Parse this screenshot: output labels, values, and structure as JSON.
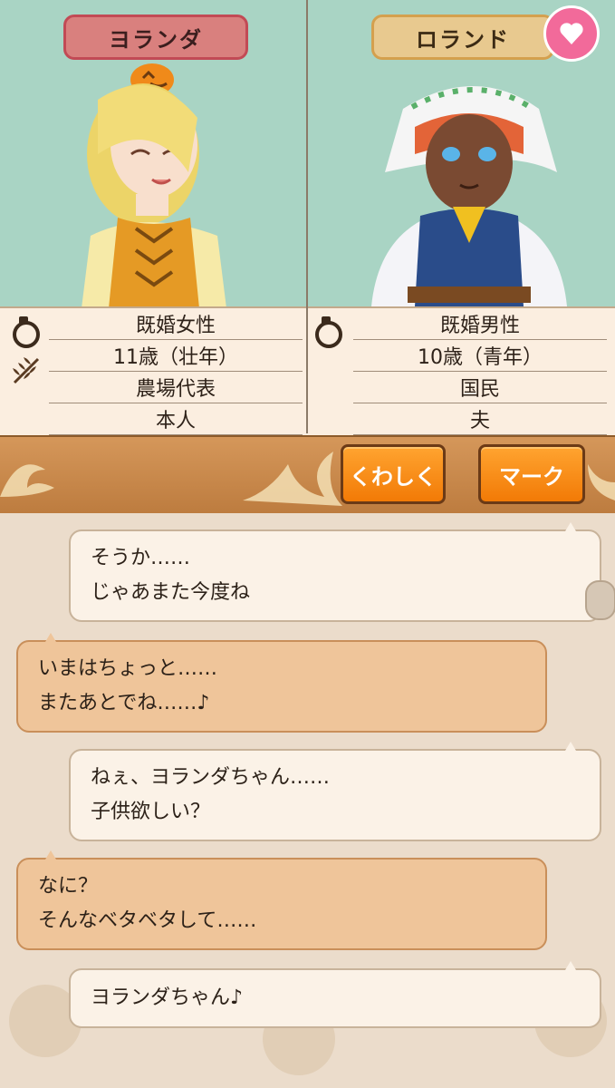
{
  "header": {
    "left_name": "ヨランダ",
    "right_name": "ロランド",
    "heart_icon": "heart-icon"
  },
  "left_profile": {
    "status": "既婚女性",
    "age": "11歳（壮年）",
    "occupation": "農場代表",
    "relation": "本人"
  },
  "right_profile": {
    "status": "既婚男性",
    "age": "10歳（青年）",
    "occupation": "国民",
    "relation": "夫"
  },
  "actions": {
    "detail_label": "くわしく",
    "mark_label": "マーク"
  },
  "messages": [
    {
      "side": "right",
      "line1": "そうか……",
      "line2": "じゃあまた今度ね"
    },
    {
      "side": "left",
      "line1": "いまはちょっと……",
      "line2": "またあとでね……♪"
    },
    {
      "side": "right",
      "line1": "ねぇ、ヨランダちゃん……",
      "line2": "子供欲しい？"
    },
    {
      "side": "left",
      "line1": "なに？",
      "line2": "そんなベタベタして……"
    },
    {
      "side": "right",
      "line1": "ヨランダちゃん♪",
      "line2": ""
    }
  ],
  "colors": {
    "portrait_bg": "#a9d4c4",
    "left_name_bg": "#d9807e",
    "right_name_bg": "#e8c98f",
    "action_button": "#f27a06",
    "left_bubble": "#efc59a",
    "right_bubble": "#fbf2e7"
  }
}
